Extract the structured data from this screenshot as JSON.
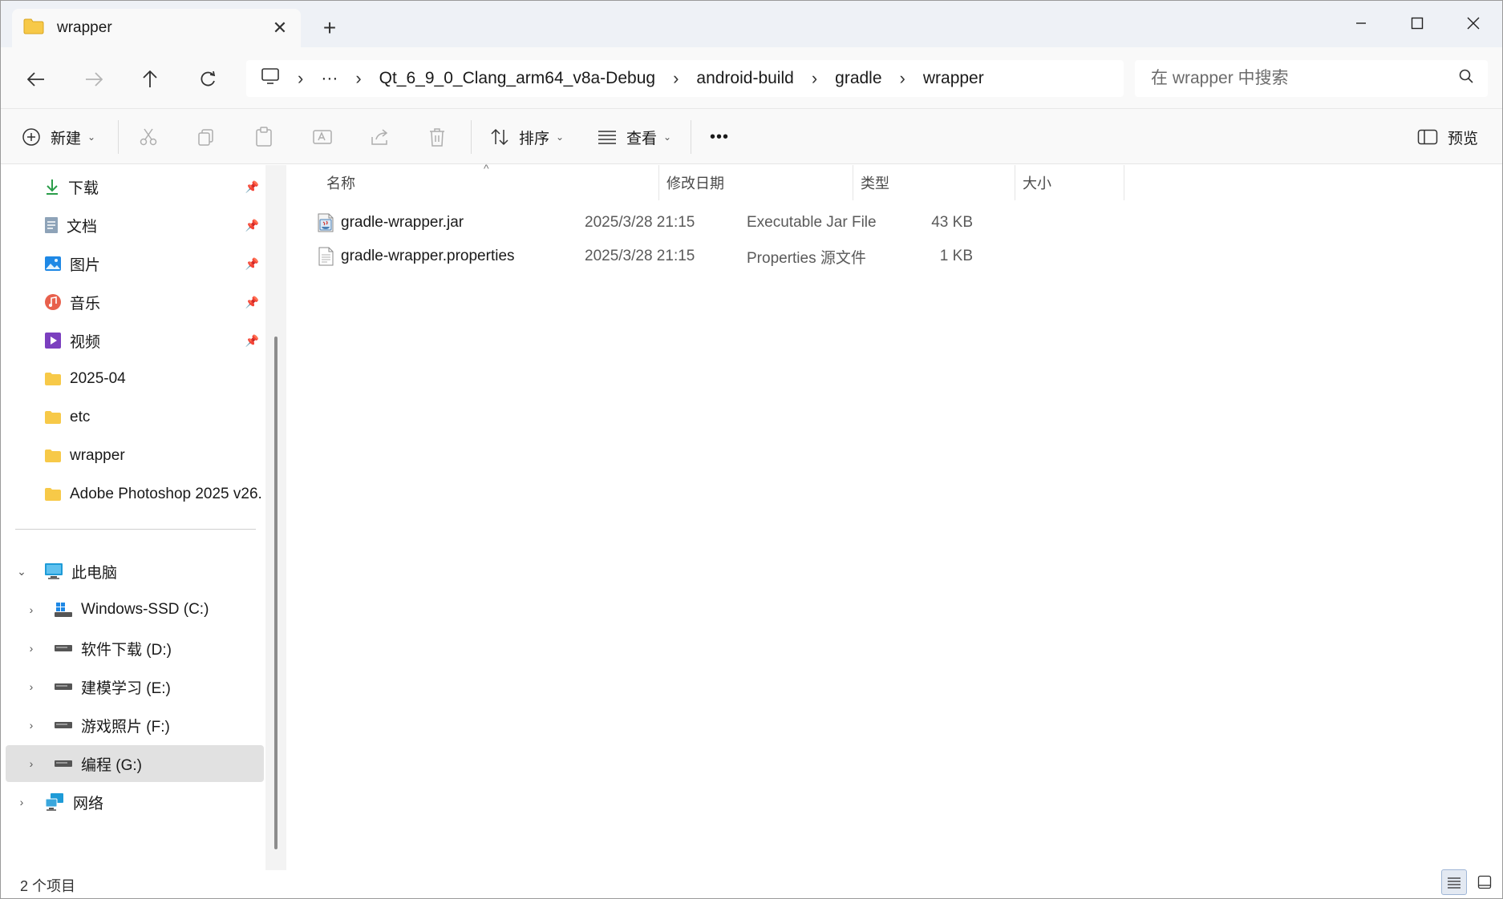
{
  "tab": {
    "title": "wrapper",
    "close_symbol": "✕",
    "new_tab_symbol": "+"
  },
  "window_controls": {
    "minimize": "minimize-icon",
    "maximize": "maximize-icon",
    "close": "close-icon"
  },
  "nav": {
    "back_icon": "arrow-left-icon",
    "forward_icon": "arrow-right-icon",
    "up_icon": "arrow-up-icon",
    "refresh_icon": "refresh-icon"
  },
  "address": {
    "overflow": "···",
    "crumbs": [
      "Qt_6_9_0_Clang_arm64_v8a-Debug",
      "android-build",
      "gradle",
      "wrapper"
    ]
  },
  "search": {
    "placeholder": "在 wrapper 中搜索"
  },
  "commands": {
    "new_label": "新建",
    "sort_label": "排序",
    "view_label": "查看",
    "more_symbol": "•••",
    "preview_label": "预览"
  },
  "sidebar": {
    "quick_access": [
      {
        "label": "下载",
        "icon": "download-icon",
        "pinned": true
      },
      {
        "label": "文档",
        "icon": "document-icon",
        "pinned": true
      },
      {
        "label": "图片",
        "icon": "pictures-icon",
        "pinned": true
      },
      {
        "label": "音乐",
        "icon": "music-icon",
        "pinned": true
      },
      {
        "label": "视频",
        "icon": "video-icon",
        "pinned": true
      },
      {
        "label": "2025-04",
        "icon": "folder-icon",
        "pinned": false
      },
      {
        "label": "etc",
        "icon": "folder-icon",
        "pinned": false
      },
      {
        "label": "wrapper",
        "icon": "folder-icon",
        "pinned": false
      },
      {
        "label": "Adobe Photoshop 2025 v26.",
        "icon": "folder-icon",
        "pinned": false
      }
    ],
    "this_pc": {
      "label": "此电脑",
      "icon": "computer-icon"
    },
    "drives": [
      {
        "label": "Windows-SSD (C:)",
        "icon": "windows-drive-icon"
      },
      {
        "label": "软件下载 (D:)",
        "icon": "drive-icon"
      },
      {
        "label": "建模学习 (E:)",
        "icon": "drive-icon"
      },
      {
        "label": "游戏照片 (F:)",
        "icon": "drive-icon"
      },
      {
        "label": "编程 (G:)",
        "icon": "drive-icon",
        "selected": true
      }
    ],
    "network": {
      "label": "网络",
      "icon": "network-icon"
    }
  },
  "columns": {
    "name": "名称",
    "date": "修改日期",
    "type": "类型",
    "size": "大小"
  },
  "files": [
    {
      "name": "gradle-wrapper.jar",
      "date": "2025/3/28 21:15",
      "type": "Executable Jar File",
      "size": "43 KB",
      "icon": "jar-file-icon"
    },
    {
      "name": "gradle-wrapper.properties",
      "date": "2025/3/28 21:15",
      "type": "Properties 源文件",
      "size": "1 KB",
      "icon": "text-file-icon"
    }
  ],
  "status": {
    "item_count": "2 个项目"
  },
  "colors": {
    "folder": "#f7c948",
    "accent": "#0067c0",
    "selected_bg": "#e1e1e1"
  }
}
